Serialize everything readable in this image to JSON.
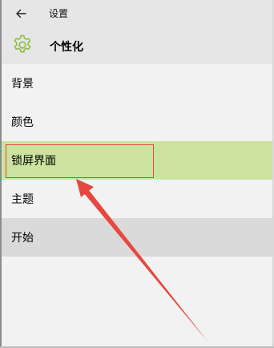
{
  "window": {
    "title": "设置"
  },
  "header": {
    "title": "个性化",
    "icon": "gear-icon",
    "accent": "#8cbf3f"
  },
  "nav": {
    "items": [
      {
        "label": "背景",
        "state": "normal"
      },
      {
        "label": "颜色",
        "state": "normal"
      },
      {
        "label": "锁屏界面",
        "state": "selected"
      },
      {
        "label": "主题",
        "state": "normal"
      },
      {
        "label": "开始",
        "state": "hover"
      }
    ]
  },
  "colors": {
    "selected": "#cce39f",
    "hover": "#dadada",
    "annotation": "#e8473e"
  }
}
